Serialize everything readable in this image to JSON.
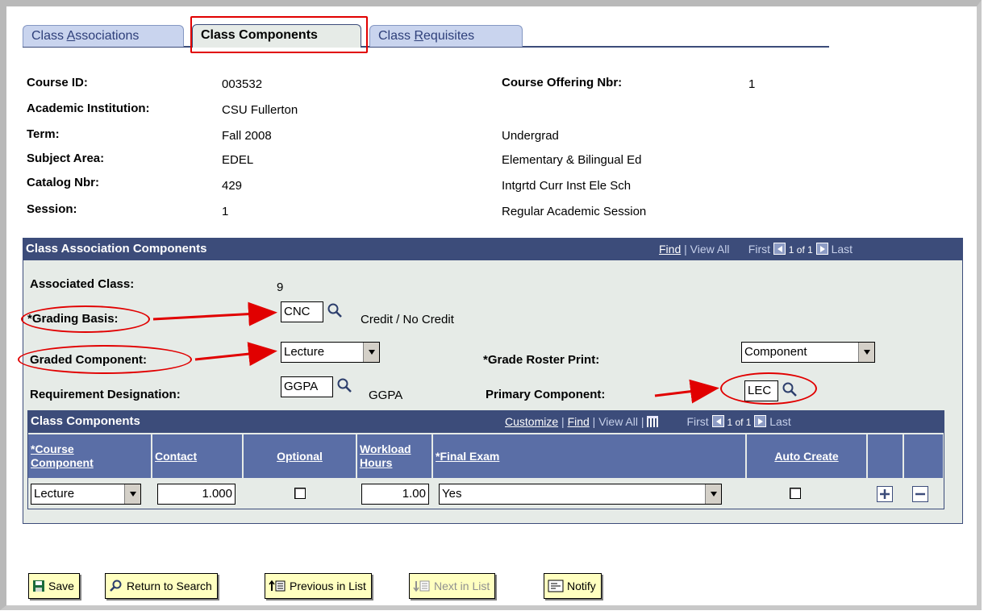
{
  "tabs": [
    {
      "label_pre": "Class ",
      "label_u": "A",
      "label_post": "ssociations"
    },
    {
      "label": "Class Components"
    },
    {
      "label_pre": "Class ",
      "label_u": "R",
      "label_post": "equisites"
    }
  ],
  "header": {
    "course_id_label": "Course ID:",
    "course_id": "003532",
    "course_offering_label": "Course Offering Nbr:",
    "course_offering": "1",
    "institution_label": "Academic Institution:",
    "institution": "CSU Fullerton",
    "term_label": "Term:",
    "term": "Fall 2008",
    "career": "Undergrad",
    "subject_label": "Subject Area:",
    "subject": "EDEL",
    "subject_desc": "Elementary & Bilingual Ed",
    "catalog_label": "Catalog Nbr:",
    "catalog": "429",
    "catalog_desc": "Intgrtd Curr Inst Ele Sch",
    "session_label": "Session:",
    "session": "1",
    "session_desc": "Regular Academic Session"
  },
  "assoc": {
    "title": "Class Association Components",
    "find": "Find",
    "view_all": "View All",
    "first": "First",
    "count": "1 of 1",
    "last": "Last",
    "associated_class_label": "Associated Class:",
    "associated_class": "9",
    "grading_basis_label": "*Grading Basis:",
    "grading_basis": "CNC",
    "grading_basis_desc": "Credit / No Credit",
    "graded_component_label": "Graded Component:",
    "graded_component": "Lecture",
    "grade_roster_label": "*Grade Roster Print:",
    "grade_roster": "Component",
    "req_designation_label": "Requirement Designation:",
    "req_designation": "GGPA",
    "req_designation_desc": "GGPA",
    "primary_component_label": "Primary Component:",
    "primary_component": "LEC"
  },
  "components": {
    "title": "Class Components",
    "customize": "Customize",
    "find": "Find",
    "view_all": "View All",
    "first": "First",
    "count": "1 of 1",
    "last": "Last",
    "columns": {
      "course_component_1": "*Course",
      "course_component_2": "Component",
      "contact": "Contact",
      "optional": "Optional",
      "workload_1": "Workload",
      "workload_2": "Hours",
      "final_exam": "*Final Exam",
      "auto_create": "Auto Create"
    },
    "row": {
      "course_component": "Lecture",
      "contact": "1.000",
      "optional": false,
      "workload": "1.00",
      "final_exam": "Yes",
      "auto_create": false
    }
  },
  "toolbar": {
    "save": "Save",
    "return_to_search": "Return to Search",
    "previous_in_list": "Previous in List",
    "next_in_list": "Next in List",
    "notify": "Notify"
  },
  "colors": {
    "header_blue": "#3c4c7a",
    "panel_bg": "#e6ebe7",
    "highlight_red": "#e10000",
    "button_yellow": "#ffffc0"
  }
}
